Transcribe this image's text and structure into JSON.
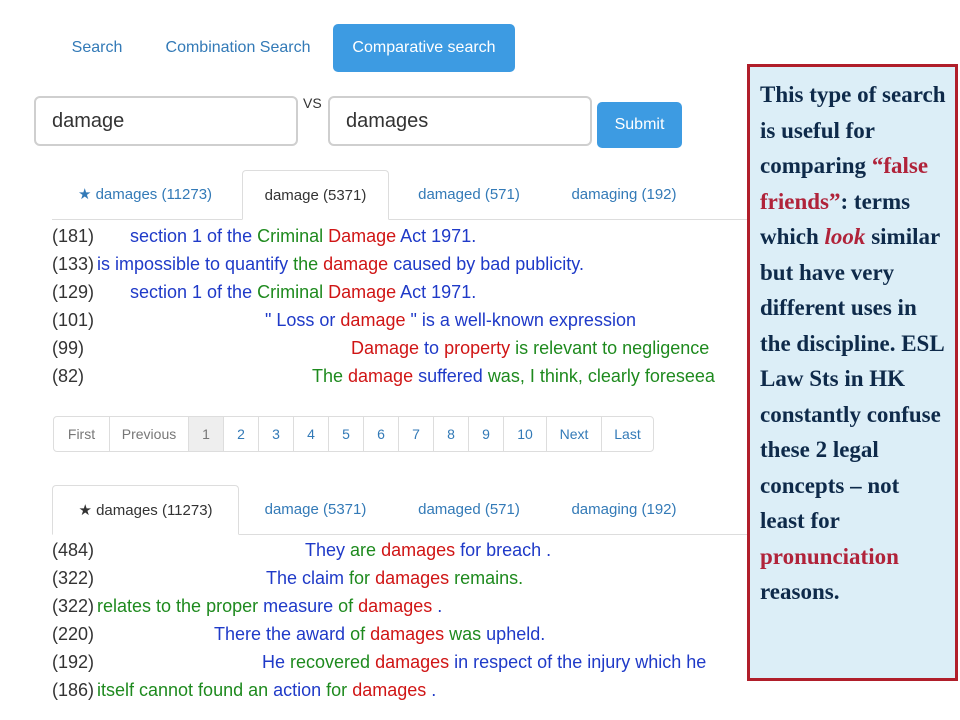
{
  "nav": {
    "tabs": [
      {
        "label": "Search",
        "active": false
      },
      {
        "label": "Combination Search",
        "active": false
      },
      {
        "label": "Comparative search",
        "active": true
      }
    ]
  },
  "compare": {
    "term1": "damage",
    "vs_label": "VS",
    "term2": "damages",
    "submit_label": "Submit"
  },
  "panel1": {
    "tabs": [
      {
        "star": "★",
        "label": "damages (11273)",
        "active": false
      },
      {
        "star": "",
        "label": "damage (5371)",
        "active": true
      },
      {
        "star": "",
        "label": "damaged (571)",
        "active": false
      },
      {
        "star": "",
        "label": "damaging (192)",
        "active": false
      }
    ],
    "lines": [
      {
        "count": "(181)",
        "segments": [
          {
            "t": "section 1 of the ",
            "c": "blue"
          },
          {
            "t": "Criminal ",
            "c": "green"
          },
          {
            "t": "Damage ",
            "c": "red"
          },
          {
            "t": "Act 1971.",
            "c": "blue"
          }
        ]
      },
      {
        "count": "(133)",
        "segments": [
          {
            "t": "is impossible to quantify ",
            "c": "blue"
          },
          {
            "t": "the ",
            "c": "green"
          },
          {
            "t": "damage ",
            "c": "red"
          },
          {
            "t": "caused ",
            "c": "blue"
          },
          {
            "t": "by bad publicity.",
            "c": "blue"
          }
        ]
      },
      {
        "count": "(129)",
        "segments": [
          {
            "t": "section 1 of the ",
            "c": "blue"
          },
          {
            "t": "Criminal ",
            "c": "green"
          },
          {
            "t": "Damage ",
            "c": "red"
          },
          {
            "t": "Act 1971.",
            "c": "blue"
          }
        ]
      },
      {
        "count": "(101)",
        "segments": [
          {
            "t": "\" Loss or ",
            "c": "blue"
          },
          {
            "t": "damage ",
            "c": "red"
          },
          {
            "t": "\" is a well-known expression",
            "c": "blue"
          }
        ]
      },
      {
        "count": "(99)",
        "segments": [
          {
            "t": "Damage ",
            "c": "red"
          },
          {
            "t": "to ",
            "c": "blue"
          },
          {
            "t": "property ",
            "c": "red"
          },
          {
            "t": "is relevant to negligence",
            "c": "green"
          }
        ]
      },
      {
        "count": "(82)",
        "segments": [
          {
            "t": "The ",
            "c": "green"
          },
          {
            "t": "damage ",
            "c": "red"
          },
          {
            "t": "suffered ",
            "c": "blue"
          },
          {
            "t": "was, I think, clearly foreseea",
            "c": "green"
          }
        ]
      }
    ]
  },
  "pagination": {
    "items": [
      "First",
      "Previous",
      "1",
      "2",
      "3",
      "4",
      "5",
      "6",
      "7",
      "8",
      "9",
      "10",
      "Next",
      "Last"
    ],
    "current": "1"
  },
  "panel2": {
    "tabs": [
      {
        "star": "★",
        "label": "damages (11273)",
        "active": true
      },
      {
        "star": "",
        "label": "damage (5371)",
        "active": false
      },
      {
        "star": "",
        "label": "damaged (571)",
        "active": false
      },
      {
        "star": "",
        "label": "damaging (192)",
        "active": false
      }
    ],
    "lines": [
      {
        "count": "(484)",
        "segments": [
          {
            "t": "They ",
            "c": "blue"
          },
          {
            "t": "are ",
            "c": "green"
          },
          {
            "t": "damages ",
            "c": "red"
          },
          {
            "t": "for breach .",
            "c": "blue"
          }
        ]
      },
      {
        "count": "(322)",
        "segments": [
          {
            "t": "The ",
            "c": "blue"
          },
          {
            "t": "claim ",
            "c": "blue"
          },
          {
            "t": "for ",
            "c": "green"
          },
          {
            "t": "damages ",
            "c": "red"
          },
          {
            "t": "remains.",
            "c": "green"
          }
        ]
      },
      {
        "count": "(322)",
        "segments": [
          {
            "t": "relates to the proper ",
            "c": "green"
          },
          {
            "t": "measure ",
            "c": "blue"
          },
          {
            "t": "of ",
            "c": "green"
          },
          {
            "t": "damages ",
            "c": "red"
          },
          {
            "t": ".",
            "c": "blue"
          }
        ]
      },
      {
        "count": "(220)",
        "segments": [
          {
            "t": "There the ",
            "c": "blue"
          },
          {
            "t": "award ",
            "c": "blue"
          },
          {
            "t": "of ",
            "c": "green"
          },
          {
            "t": "damages ",
            "c": "red"
          },
          {
            "t": "was ",
            "c": "green"
          },
          {
            "t": "upheld.",
            "c": "blue"
          }
        ]
      },
      {
        "count": "(192)",
        "segments": [
          {
            "t": "He ",
            "c": "blue"
          },
          {
            "t": "recovered ",
            "c": "green"
          },
          {
            "t": "damages ",
            "c": "red"
          },
          {
            "t": "in respect ",
            "c": "blue"
          },
          {
            "t": "of the injury which he",
            "c": "blue"
          }
        ]
      },
      {
        "count": "(186)",
        "segments": [
          {
            "t": "itself cannot found an ",
            "c": "green"
          },
          {
            "t": "action ",
            "c": "blue"
          },
          {
            "t": "for ",
            "c": "green"
          },
          {
            "t": "damages ",
            "c": "red"
          },
          {
            "t": ".",
            "c": "blue"
          }
        ]
      }
    ]
  },
  "callout": {
    "p1": "This type of search is useful for comparing ",
    "quoted": "“false friends”",
    "p2": ": terms which ",
    "look": "look",
    "p3": " similar but have very different uses in the discipline. ESL Law Sts in HK constantly confuse these 2 legal concepts – not least for ",
    "pron": "pronunciation",
    "p4": " reasons."
  },
  "colors": {
    "blue": "#1f3ac8",
    "green": "#1e8a1e",
    "red": "#d01515",
    "accent": "#3d9be2",
    "callout_border": "#b01e2a",
    "callout_bg": "#dceef7"
  }
}
